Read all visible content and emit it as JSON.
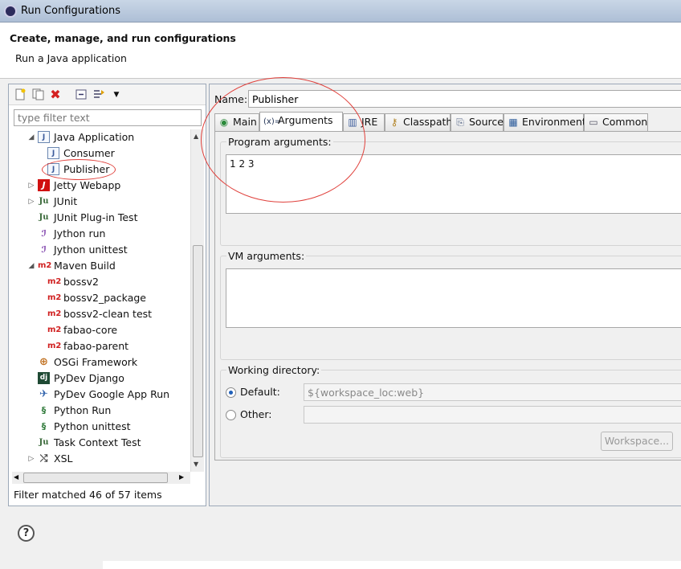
{
  "window": {
    "title": "Run Configurations"
  },
  "header": {
    "title": "Create, manage, and run configurations",
    "subtitle": "Run a Java application"
  },
  "sidebar": {
    "filter_placeholder": "type filter text",
    "toolbar": [
      "new-config-icon",
      "duplicate-icon",
      "delete-icon",
      "collapse-all-icon",
      "filter-icon",
      "dropdown-icon"
    ],
    "items": [
      {
        "label": "Java Application",
        "level": 0,
        "expanded": true,
        "icon": "java-app-icon"
      },
      {
        "label": "Consumer",
        "level": 1,
        "icon": "java-file-icon"
      },
      {
        "label": "Publisher",
        "level": 1,
        "icon": "java-file-icon",
        "selected": true
      },
      {
        "label": "Jetty Webapp",
        "level": 0,
        "expanded": false,
        "icon": "jetty-icon"
      },
      {
        "label": "JUnit",
        "level": 0,
        "expanded": false,
        "icon": "junit-icon"
      },
      {
        "label": "JUnit Plug-in Test",
        "level": 0,
        "icon": "junit-plugin-icon"
      },
      {
        "label": "Jython run",
        "level": 0,
        "icon": "jython-icon"
      },
      {
        "label": "Jython unittest",
        "level": 0,
        "icon": "jython-unittest-icon"
      },
      {
        "label": "Maven Build",
        "level": 0,
        "expanded": true,
        "icon": "maven-icon"
      },
      {
        "label": "bossv2",
        "level": 1,
        "icon": "maven-icon"
      },
      {
        "label": "bossv2_package",
        "level": 1,
        "icon": "maven-icon"
      },
      {
        "label": "bossv2-clean test",
        "level": 1,
        "icon": "maven-icon"
      },
      {
        "label": "fabao-core",
        "level": 1,
        "icon": "maven-icon"
      },
      {
        "label": "fabao-parent",
        "level": 1,
        "icon": "maven-icon"
      },
      {
        "label": "OSGi Framework",
        "level": 0,
        "icon": "osgi-icon"
      },
      {
        "label": "PyDev Django",
        "level": 0,
        "icon": "django-icon"
      },
      {
        "label": "PyDev Google App Run",
        "level": 0,
        "icon": "google-app-icon"
      },
      {
        "label": "Python Run",
        "level": 0,
        "icon": "python-icon"
      },
      {
        "label": "Python unittest",
        "level": 0,
        "icon": "python-unittest-icon"
      },
      {
        "label": "Task Context Test",
        "level": 0,
        "icon": "task-context-icon"
      },
      {
        "label": "XSL",
        "level": 0,
        "expanded": false,
        "icon": "xsl-icon"
      }
    ],
    "status": "Filter matched 46 of 57 items"
  },
  "main": {
    "name_label": "Name:",
    "name_value": "Publisher",
    "tabs": [
      {
        "label": "Main",
        "icon": "main-tab-icon"
      },
      {
        "label": "Arguments",
        "icon": "arguments-tab-icon",
        "active": true
      },
      {
        "label": "JRE",
        "icon": "jre-tab-icon"
      },
      {
        "label": "Classpath",
        "icon": "classpath-tab-icon"
      },
      {
        "label": "Source",
        "icon": "source-tab-icon"
      },
      {
        "label": "Environment",
        "icon": "environment-tab-icon"
      },
      {
        "label": "Common",
        "icon": "common-tab-icon"
      }
    ],
    "program_args": {
      "label": "Program arguments:",
      "value": "1 2 3"
    },
    "vm_args": {
      "label": "VM arguments:",
      "value": ""
    },
    "working_dir": {
      "label": "Working directory:",
      "default_label": "Default:",
      "default_value": "${workspace_loc:web}",
      "other_label": "Other:",
      "other_value": "",
      "workspace_button": "Workspace..."
    }
  },
  "footer": {
    "help_glyph": "?"
  },
  "colors": {
    "annotation": "#e0413c",
    "accent": "#1f5fb8"
  }
}
